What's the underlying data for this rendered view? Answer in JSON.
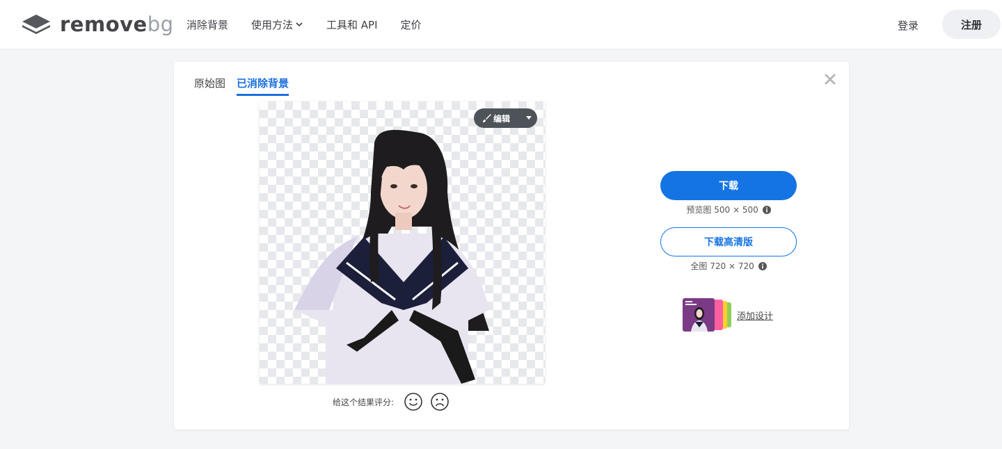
{
  "header": {
    "logo": {
      "main": "remove",
      "accent": "bg"
    },
    "nav": [
      {
        "label": "消除背景"
      },
      {
        "label": "使用方法",
        "has_dropdown": true
      },
      {
        "label": "工具和 API"
      },
      {
        "label": "定价"
      }
    ],
    "login_label": "登录",
    "signup_label": "注册"
  },
  "editor": {
    "tabs": [
      {
        "label": "原始图",
        "active": false
      },
      {
        "label": "已消除背景",
        "active": true
      }
    ],
    "edit_button_label": "编辑",
    "rating_prompt": "给这个结果评分:",
    "download": {
      "button_label": "下载",
      "preview_label": "预览图 500 × 500",
      "hd_button_label": "下载高清版",
      "hd_label": "全图 720 × 720"
    },
    "add_design_label": "添加设计"
  },
  "colors": {
    "accent": "#1574e4",
    "edit_button": "#4d5359",
    "signup_bg": "#eef0f3"
  },
  "icons": [
    "logo-layers-icon",
    "chevron-down-icon",
    "close-icon",
    "brush-icon",
    "caret-down-icon",
    "smile-icon",
    "frown-icon",
    "info-icon"
  ]
}
